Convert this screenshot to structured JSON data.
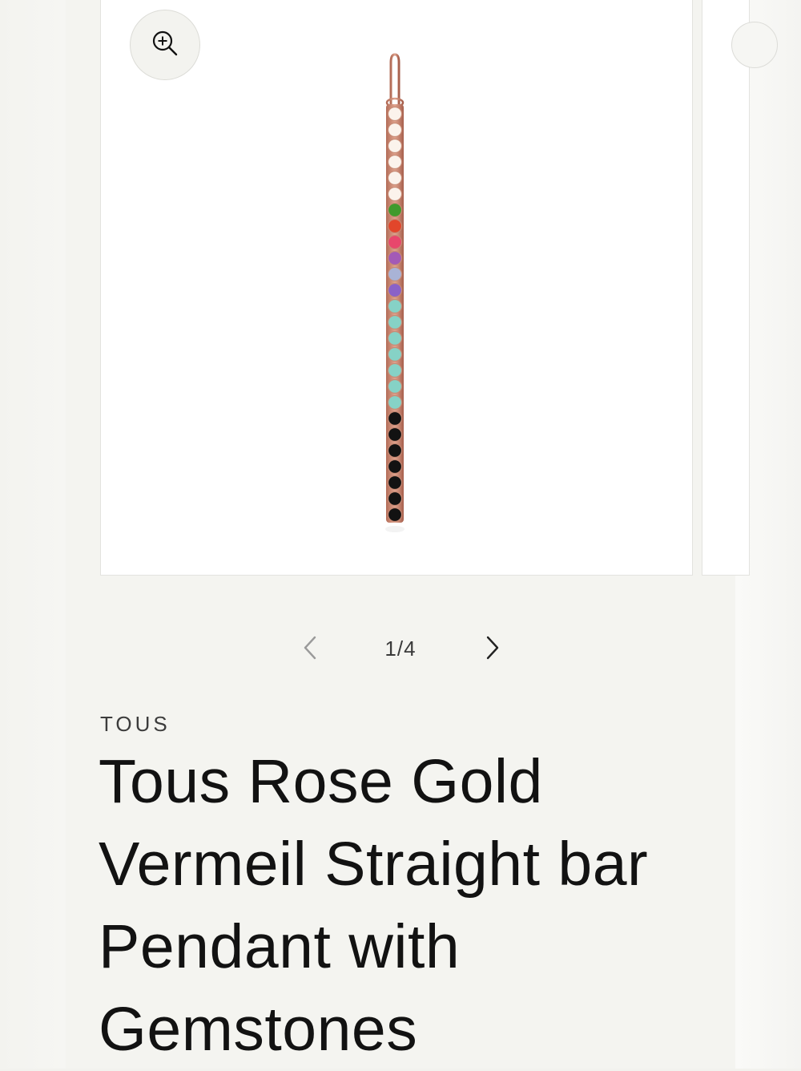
{
  "gallery": {
    "zoom_icon": "zoom-in-icon",
    "counter": "1/4",
    "prev_icon": "chevron-left-icon",
    "next_icon": "chevron-right-icon"
  },
  "product": {
    "vendor": "TOUS",
    "title": "Tous Rose Gold Vermeil Straight bar Pendant with Gemstones"
  },
  "colors": {
    "background": "#f4f4f0",
    "text": "#121212",
    "rose_gold": "#c98670"
  }
}
